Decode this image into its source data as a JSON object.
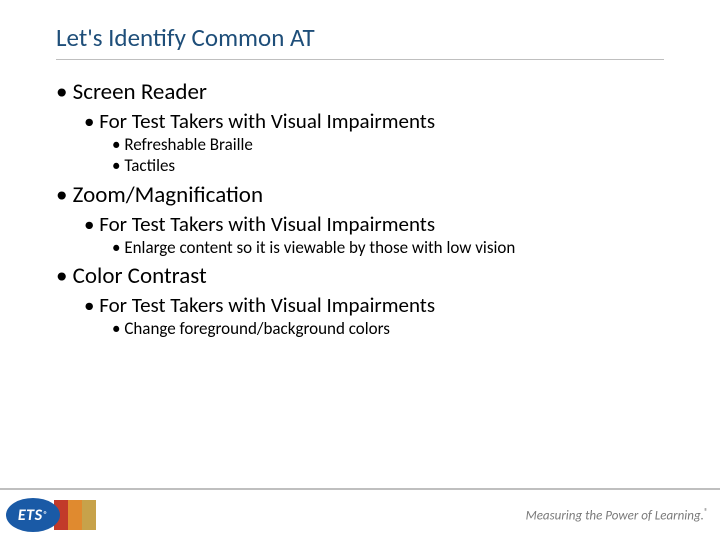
{
  "title": "Let's Identify Common AT",
  "bullets": {
    "b1": "Screen Reader",
    "b1_1": "For Test Takers with Visual Impairments",
    "b1_1_1": "Refreshable Braille",
    "b1_1_2": "Tactiles",
    "b2": "Zoom/Magnification",
    "b2_1": "For Test Takers with Visual Impairments",
    "b2_1_1": "Enlarge content so it is viewable by those with low vision",
    "b3": "Color Contrast",
    "b3_1": "For Test Takers with Visual Impairments",
    "b3_1_1": "Change foreground/background colors"
  },
  "footer": {
    "logo_text": "ETS",
    "tagline": "Measuring the Power of Learning."
  }
}
